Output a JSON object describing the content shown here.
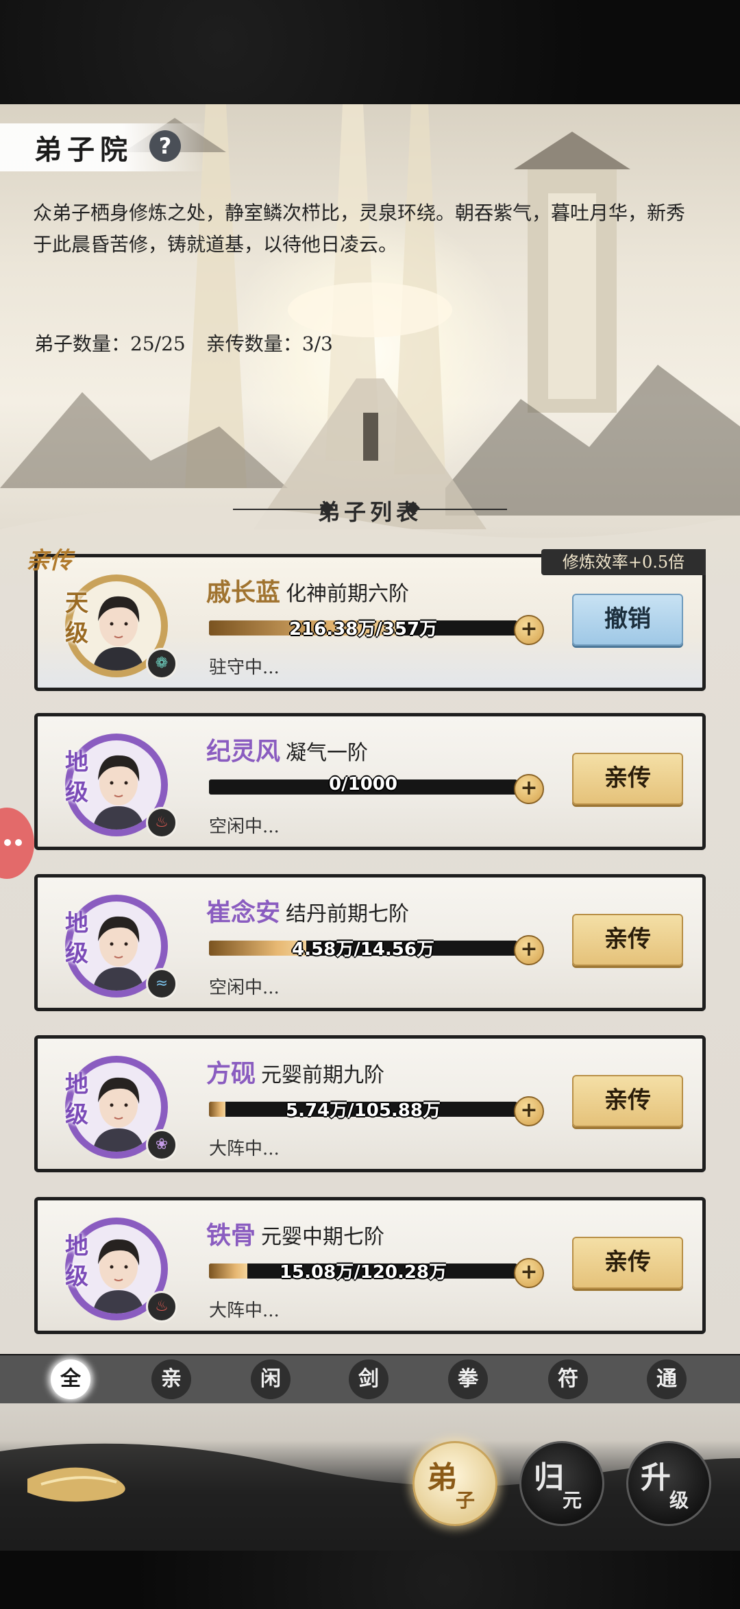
{
  "header": {
    "title": "弟子院",
    "help_icon": "?",
    "description": "众弟子栖身修炼之处，静室鳞次栉比，灵泉环绕。朝吞紫气，暮吐月华，新秀于此晨昏苦修，铸就道基，以待他日凌云。",
    "disciple_count": "弟子数量：25/25",
    "personal_count": "亲传数量：3/3"
  },
  "list": {
    "section_title": "弟子列表",
    "personal_label": "亲传",
    "bonus_tag": "修炼效率+0.5倍",
    "plus_label": "+",
    "colors": {
      "gold": "#a0732f",
      "purple": "#8a5cc0",
      "bar_fill": "#e7b873"
    },
    "disciples": [
      {
        "grade": "天级",
        "grade_color": "gold",
        "element_icon": "wind-icon",
        "name": "戚长蓝",
        "realm": "化神前期六阶",
        "progress_text": "216.38万/357万",
        "progress": 0.606,
        "status": "驻守中...",
        "action": "撤销",
        "action_style": "blue"
      },
      {
        "grade": "地级",
        "grade_color": "purple",
        "element_icon": "fire-icon",
        "name": "纪灵风",
        "realm": "凝气一阶",
        "progress_text": "0/1000",
        "progress": 0.0,
        "status": "空闲中...",
        "action": "亲传",
        "action_style": "gold"
      },
      {
        "grade": "地级",
        "grade_color": "purple",
        "element_icon": "water-icon",
        "name": "崔念安",
        "realm": "结丹前期七阶",
        "progress_text": "4.58万/14.56万",
        "progress": 0.315,
        "status": "空闲中...",
        "action": "亲传",
        "action_style": "gold"
      },
      {
        "grade": "地级",
        "grade_color": "purple",
        "element_icon": "flame-icon",
        "name": "方砚",
        "realm": "元婴前期九阶",
        "progress_text": "5.74万/105.88万",
        "progress": 0.054,
        "status": "大阵中...",
        "action": "亲传",
        "action_style": "gold"
      },
      {
        "grade": "地级",
        "grade_color": "purple",
        "element_icon": "fire-icon",
        "name": "铁骨",
        "realm": "元婴中期七阶",
        "progress_text": "15.08万/120.28万",
        "progress": 0.125,
        "status": "大阵中...",
        "action": "亲传",
        "action_style": "gold"
      }
    ]
  },
  "filters": {
    "active": 0,
    "items": [
      "全",
      "亲",
      "闲",
      "剑",
      "拳",
      "符",
      "通"
    ]
  },
  "nav": {
    "items": [
      {
        "main": "弟",
        "sub": "子",
        "active": true
      },
      {
        "main": "归",
        "sub": "元",
        "active": false
      },
      {
        "main": "升",
        "sub": "级",
        "active": false
      }
    ]
  }
}
